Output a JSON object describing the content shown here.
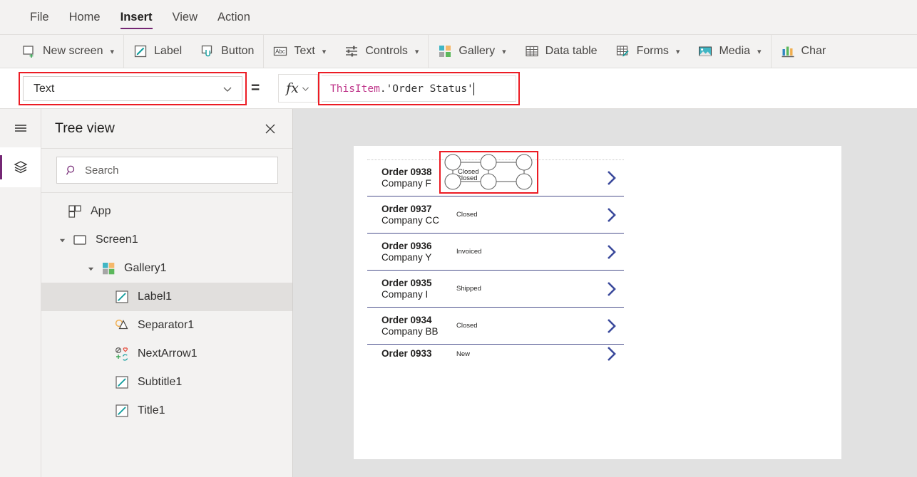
{
  "menubar": {
    "items": [
      {
        "label": "File",
        "active": false
      },
      {
        "label": "Home",
        "active": false
      },
      {
        "label": "Insert",
        "active": true
      },
      {
        "label": "View",
        "active": false
      },
      {
        "label": "Action",
        "active": false
      }
    ]
  },
  "ribbon": {
    "items": [
      {
        "label": "New screen",
        "icon": "new-screen-icon",
        "caret": true
      },
      {
        "label": "Label",
        "icon": "label-icon",
        "caret": false
      },
      {
        "label": "Button",
        "icon": "button-icon",
        "caret": false
      },
      {
        "label": "Text",
        "icon": "text-abc-icon",
        "caret": true
      },
      {
        "label": "Controls",
        "icon": "controls-sliders-icon",
        "caret": true
      },
      {
        "label": "Gallery",
        "icon": "gallery-icon",
        "caret": true
      },
      {
        "label": "Data table",
        "icon": "data-table-icon",
        "caret": false
      },
      {
        "label": "Forms",
        "icon": "forms-icon",
        "caret": true
      },
      {
        "label": "Media",
        "icon": "media-image-icon",
        "caret": true
      },
      {
        "label": "Char",
        "icon": "charts-icon",
        "caret": false
      }
    ]
  },
  "formula_bar": {
    "property_selected": "Text",
    "equals": "=",
    "fx_label": "fx",
    "formula_token_identifier": "ThisItem",
    "formula_token_rest": ".'Order Status'"
  },
  "tree_panel": {
    "title": "Tree view",
    "close_label": "✕",
    "search_placeholder": "Search",
    "items": [
      {
        "label": "App",
        "icon": "app-icon",
        "indent": 0,
        "twisty": "",
        "selected": false
      },
      {
        "label": "Screen1",
        "icon": "screen-icon",
        "indent": 0,
        "twisty": "expanded",
        "selected": false
      },
      {
        "label": "Gallery1",
        "icon": "gallery-tree-icon",
        "indent": 1,
        "twisty": "expanded",
        "selected": false
      },
      {
        "label": "Label1",
        "icon": "label-tree-icon",
        "indent": 2,
        "twisty": "",
        "selected": true
      },
      {
        "label": "Separator1",
        "icon": "shapes-icon",
        "indent": 2,
        "twisty": "",
        "selected": false
      },
      {
        "label": "NextArrow1",
        "icon": "icons-tree-icon",
        "indent": 2,
        "twisty": "",
        "selected": false
      },
      {
        "label": "Subtitle1",
        "icon": "label-tree-icon",
        "indent": 2,
        "twisty": "",
        "selected": false
      },
      {
        "label": "Title1",
        "icon": "label-tree-icon",
        "indent": 2,
        "twisty": "",
        "selected": false
      }
    ]
  },
  "rail": {
    "hamburger": "hamburger-icon",
    "active_tool": "tree-view-layers-icon"
  },
  "canvas": {
    "gallery_rows": [
      {
        "title": "Order 0938",
        "subtitle": "Company F",
        "status": "Closed",
        "selected": true
      },
      {
        "title": "Order 0937",
        "subtitle": "Company CC",
        "status": "Closed",
        "selected": false
      },
      {
        "title": "Order 0936",
        "subtitle": "Company Y",
        "status": "Invoiced",
        "selected": false
      },
      {
        "title": "Order 0935",
        "subtitle": "Company I",
        "status": "Shipped",
        "selected": false
      },
      {
        "title": "Order 0934",
        "subtitle": "Company BB",
        "status": "Closed",
        "selected": false
      },
      {
        "title": "Order 0933",
        "subtitle": "",
        "status": "New",
        "selected": false
      }
    ],
    "selected_label_text": "Closed"
  },
  "colors": {
    "accent_purple": "#742774",
    "selection_red": "#ec1c24",
    "formula_identifier": "#c0398c",
    "chevron_blue": "#3b4a9c",
    "panel_bg": "#f3f2f1",
    "canvas_bg": "#e1e1e1"
  }
}
